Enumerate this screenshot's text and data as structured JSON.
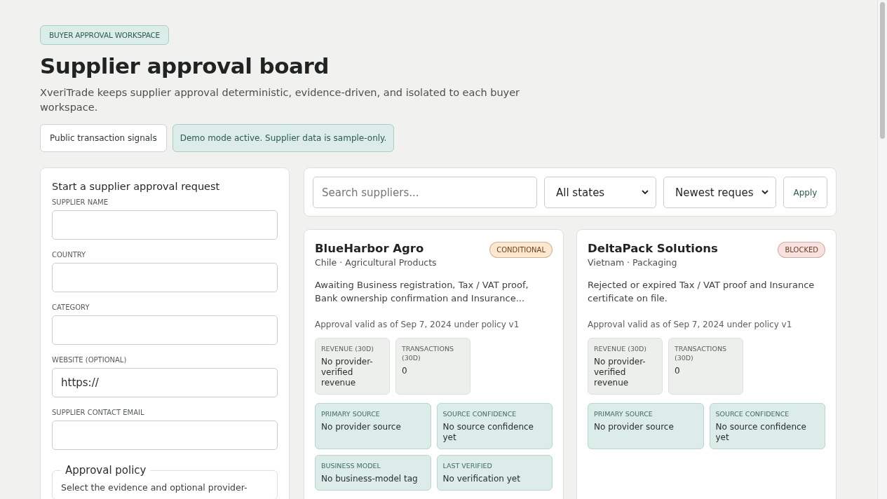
{
  "badge": "BUYER APPROVAL WORKSPACE",
  "title": "Supplier approval board",
  "description": "XveriTrade keeps supplier approval deterministic, evidence-driven, and isolated to each buyer workspace.",
  "actions": [
    {
      "kind": "button",
      "label": "Public transaction signals"
    },
    {
      "kind": "notice",
      "label": "Demo mode active. Supplier data is sample-only."
    }
  ],
  "form": {
    "title": "Start a supplier approval request",
    "fields": [
      {
        "label": "SUPPLIER NAME"
      },
      {
        "label": "COUNTRY"
      },
      {
        "label": "CATEGORY"
      },
      {
        "label": "WEBSITE (OPTIONAL)",
        "value": "https://"
      },
      {
        "label": "SUPPLIER CONTACT EMAIL"
      }
    ],
    "policy": {
      "legend": "Approval policy",
      "text": "Select the evidence and optional provider-"
    }
  },
  "filters": {
    "search": {
      "placeholder": "Search suppliers..."
    },
    "selects": [
      "All states",
      "Newest reques"
    ],
    "apply": "Apply"
  },
  "cards": [
    {
      "name": "BlueHarbor Agro",
      "meta": "Chile · Agricultural Products",
      "status": "CONDITIONAL",
      "color": "#fbe8cf",
      "summary": "Awaiting Business registration, Tax / VAT proof, Bank ownership confirmation and Insurance...",
      "validity": "Approval valid as of Sep 7, 2024 under policy v1",
      "metrics": [
        {
          "label": "REVENUE (30D)",
          "value": "No provider-verified revenue"
        },
        {
          "label": "TRANSACTIONS (30D)",
          "value": "0"
        }
      ],
      "details": [
        {
          "label": "PRIMARY SOURCE",
          "value": "No provider source"
        },
        {
          "label": "SOURCE CONFIDENCE",
          "value": "No source confidence yet"
        },
        {
          "label": "BUSINESS MODEL",
          "value": "No business-model tag"
        },
        {
          "label": "LAST VERIFIED",
          "value": "No verification yet"
        }
      ]
    },
    {
      "name": "DeltaPack Solutions",
      "meta": "Vietnam · Packaging",
      "status": "BLOCKED",
      "color": "#f8e1e1",
      "summary": "Rejected or expired Tax / VAT proof and Insurance certificate on file.",
      "validity": "Approval valid as of Sep 7, 2024 under policy v1",
      "metrics": [
        {
          "label": "REVENUE (30D)",
          "value": "No provider-verified revenue"
        },
        {
          "label": "TRANSACTIONS (30D)",
          "value": "0"
        }
      ],
      "details": [
        {
          "label": "PRIMARY SOURCE",
          "value": "No provider source"
        },
        {
          "label": "SOURCE CONFIDENCE",
          "value": "No source confidence yet"
        }
      ]
    }
  ]
}
